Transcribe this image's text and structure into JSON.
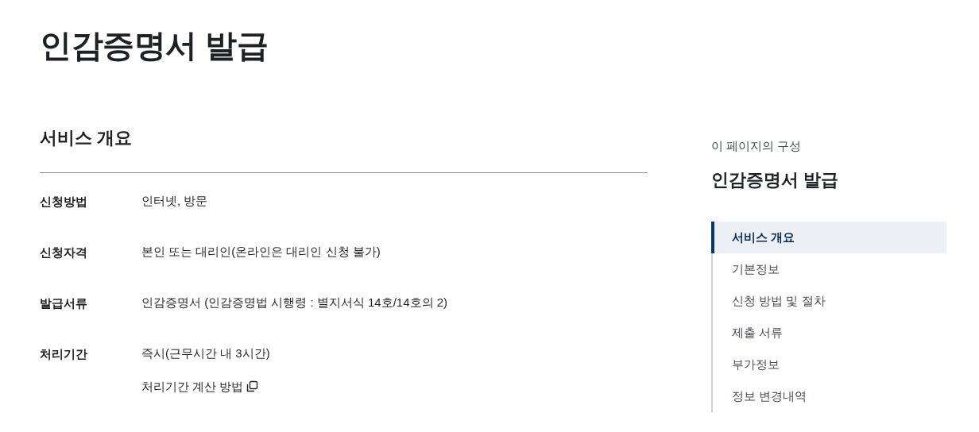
{
  "page_title": "인감증명서 발급",
  "section": {
    "heading": "서비스 개요",
    "rows": [
      {
        "label": "신청방법",
        "values": [
          {
            "kind": "text",
            "text": "인터넷, 방문"
          }
        ]
      },
      {
        "label": "신청자격",
        "values": [
          {
            "kind": "text",
            "text": "본인 또는 대리인(온라인은 대리인 신청 불가)"
          }
        ]
      },
      {
        "label": "발급서류",
        "values": [
          {
            "kind": "text",
            "text": "인감증명서 (인감증명법 시행령 : 별지서식 14호/14호의 2)"
          }
        ]
      },
      {
        "label": "처리기간",
        "values": [
          {
            "kind": "text",
            "text": "즉시(근무시간 내 3시간)"
          },
          {
            "kind": "link",
            "text": "처리기간 계산 방법"
          }
        ]
      }
    ]
  },
  "toc": {
    "caption": "이 페이지의 구성",
    "title": "인감증명서 발급",
    "items": [
      {
        "label": "서비스 개요",
        "selected": true
      },
      {
        "label": "기본정보",
        "selected": false
      },
      {
        "label": "신청 방법 및 절차",
        "selected": false
      },
      {
        "label": "제출 서류",
        "selected": false
      },
      {
        "label": "부가정보",
        "selected": false
      },
      {
        "label": "정보 변경내역",
        "selected": false
      }
    ]
  }
}
